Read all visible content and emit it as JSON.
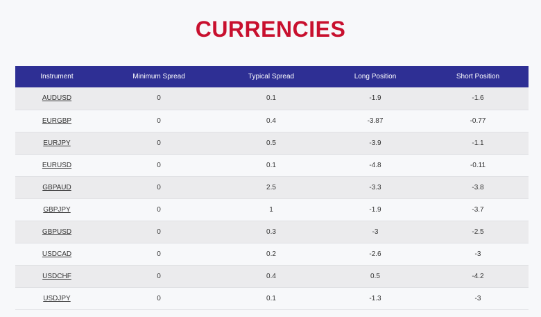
{
  "page": {
    "title": "CURRENCIES"
  },
  "table": {
    "headers": [
      "Instrument",
      "Minimum Spread",
      "Typical Spread",
      "Long Position",
      "Short Position"
    ],
    "rows": [
      {
        "instrument": "AUDUSD",
        "min_spread": "0",
        "typical_spread": "0.1",
        "long": "-1.9",
        "short": "-1.6"
      },
      {
        "instrument": "EURGBP",
        "min_spread": "0",
        "typical_spread": "0.4",
        "long": "-3.87",
        "short": "-0.77"
      },
      {
        "instrument": "EURJPY",
        "min_spread": "0",
        "typical_spread": "0.5",
        "long": "-3.9",
        "short": "-1.1"
      },
      {
        "instrument": "EURUSD",
        "min_spread": "0",
        "typical_spread": "0.1",
        "long": "-4.8",
        "short": "-0.11"
      },
      {
        "instrument": "GBPAUD",
        "min_spread": "0",
        "typical_spread": "2.5",
        "long": "-3.3",
        "short": "-3.8"
      },
      {
        "instrument": "GBPJPY",
        "min_spread": "0",
        "typical_spread": "1",
        "long": "-1.9",
        "short": "-3.7"
      },
      {
        "instrument": "GBPUSD",
        "min_spread": "0",
        "typical_spread": "0.3",
        "long": "-3",
        "short": "-2.5"
      },
      {
        "instrument": "USDCAD",
        "min_spread": "0",
        "typical_spread": "0.2",
        "long": "-2.6",
        "short": "-3"
      },
      {
        "instrument": "USDCHF",
        "min_spread": "0",
        "typical_spread": "0.4",
        "long": "0.5",
        "short": "-4.2"
      },
      {
        "instrument": "USDJPY",
        "min_spread": "0",
        "typical_spread": "0.1",
        "long": "-1.3",
        "short": "-3"
      }
    ]
  },
  "colors": {
    "title": "#c8102e",
    "header_bg": "#2e2f94",
    "row_odd": "#ebebed",
    "row_even": "#f7f8fa"
  }
}
